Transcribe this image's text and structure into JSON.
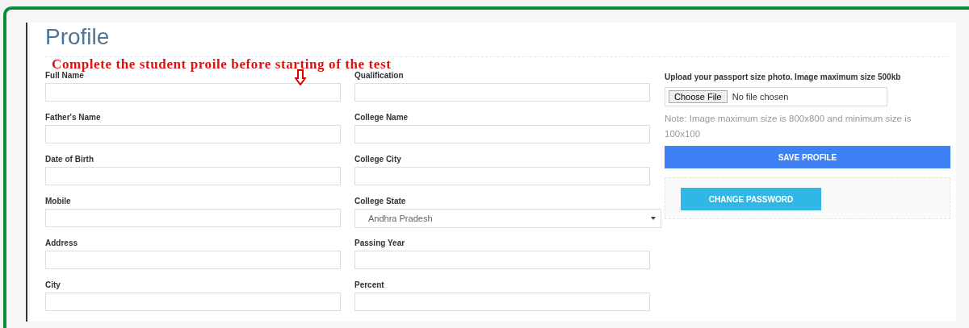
{
  "page": {
    "title": "Profile",
    "notice": "Complete the student proile before starting of the test"
  },
  "columns": [
    {
      "fields": [
        {
          "label": "Full Name",
          "kind": "text"
        },
        {
          "label": "Father's Name",
          "kind": "text"
        },
        {
          "label": "Date of Birth",
          "kind": "text"
        },
        {
          "label": "Mobile",
          "kind": "text"
        },
        {
          "label": "Address",
          "kind": "text"
        },
        {
          "label": "City",
          "kind": "text"
        }
      ]
    },
    {
      "fields": [
        {
          "label": "Qualification",
          "kind": "text"
        },
        {
          "label": "College Name",
          "kind": "text"
        },
        {
          "label": "College City",
          "kind": "text"
        },
        {
          "label": "College State",
          "kind": "select",
          "value": "Andhra Pradesh"
        },
        {
          "label": "Passing Year",
          "kind": "text"
        },
        {
          "label": "Percent",
          "kind": "text"
        }
      ]
    }
  ],
  "photo": {
    "label": "Upload your passport size photo. Image maximum size 500kb",
    "button": "Choose File",
    "status": "No file chosen",
    "note": "Note: Image maximum size is 800x800 and minimum size is 100x100"
  },
  "buttons": {
    "save": "SAVE PROFILE",
    "change_password": "CHANGE PASSWORD"
  }
}
